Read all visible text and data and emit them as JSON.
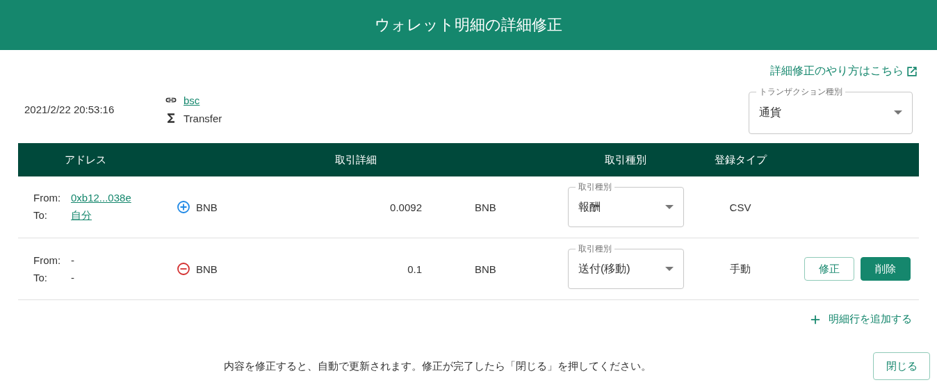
{
  "window": {
    "title": "ウォレット明細の詳細修正"
  },
  "help_link": {
    "label": "詳細修正のやり方はこちら"
  },
  "transaction": {
    "datetime": "2021/2/22 20:53:16",
    "network": "bsc",
    "method": "Transfer",
    "type_select": {
      "label": "トランザクション種別",
      "value": "通貨"
    }
  },
  "table": {
    "columns": [
      {
        "label": "アドレス"
      },
      {
        "label": "取引詳細"
      },
      {
        "label": "取引種別"
      },
      {
        "label": "登録タイプ"
      }
    ],
    "rows": [
      {
        "from_label": "From:",
        "from": {
          "text": "0xb12...038e",
          "link": true
        },
        "to_label": "To:",
        "to": {
          "text": "自分",
          "link": true
        },
        "incoming": true,
        "asset": "BNB",
        "amount": "0.0092",
        "currency": "BNB",
        "type_select": {
          "label": "取引種別",
          "value": "報酬"
        },
        "register_type": "CSV",
        "buttons": []
      },
      {
        "from_label": "From:",
        "from": {
          "text": "-",
          "link": false
        },
        "to_label": "To:",
        "to": {
          "text": "-",
          "link": false
        },
        "incoming": false,
        "asset": "BNB",
        "amount": "0.1",
        "currency": "BNB",
        "type_select": {
          "label": "取引種別",
          "value": "送付(移動)"
        },
        "register_type": "手動",
        "buttons": [
          {
            "label": "修正",
            "kind": "outline"
          },
          {
            "label": "削除",
            "kind": "filled"
          }
        ]
      }
    ]
  },
  "add_row": {
    "label": "明細行を追加する"
  },
  "footer": {
    "message": "内容を修正すると、自動で更新されます。修正が完了したら「閉じる」を押してください。",
    "close": "閉じる"
  }
}
